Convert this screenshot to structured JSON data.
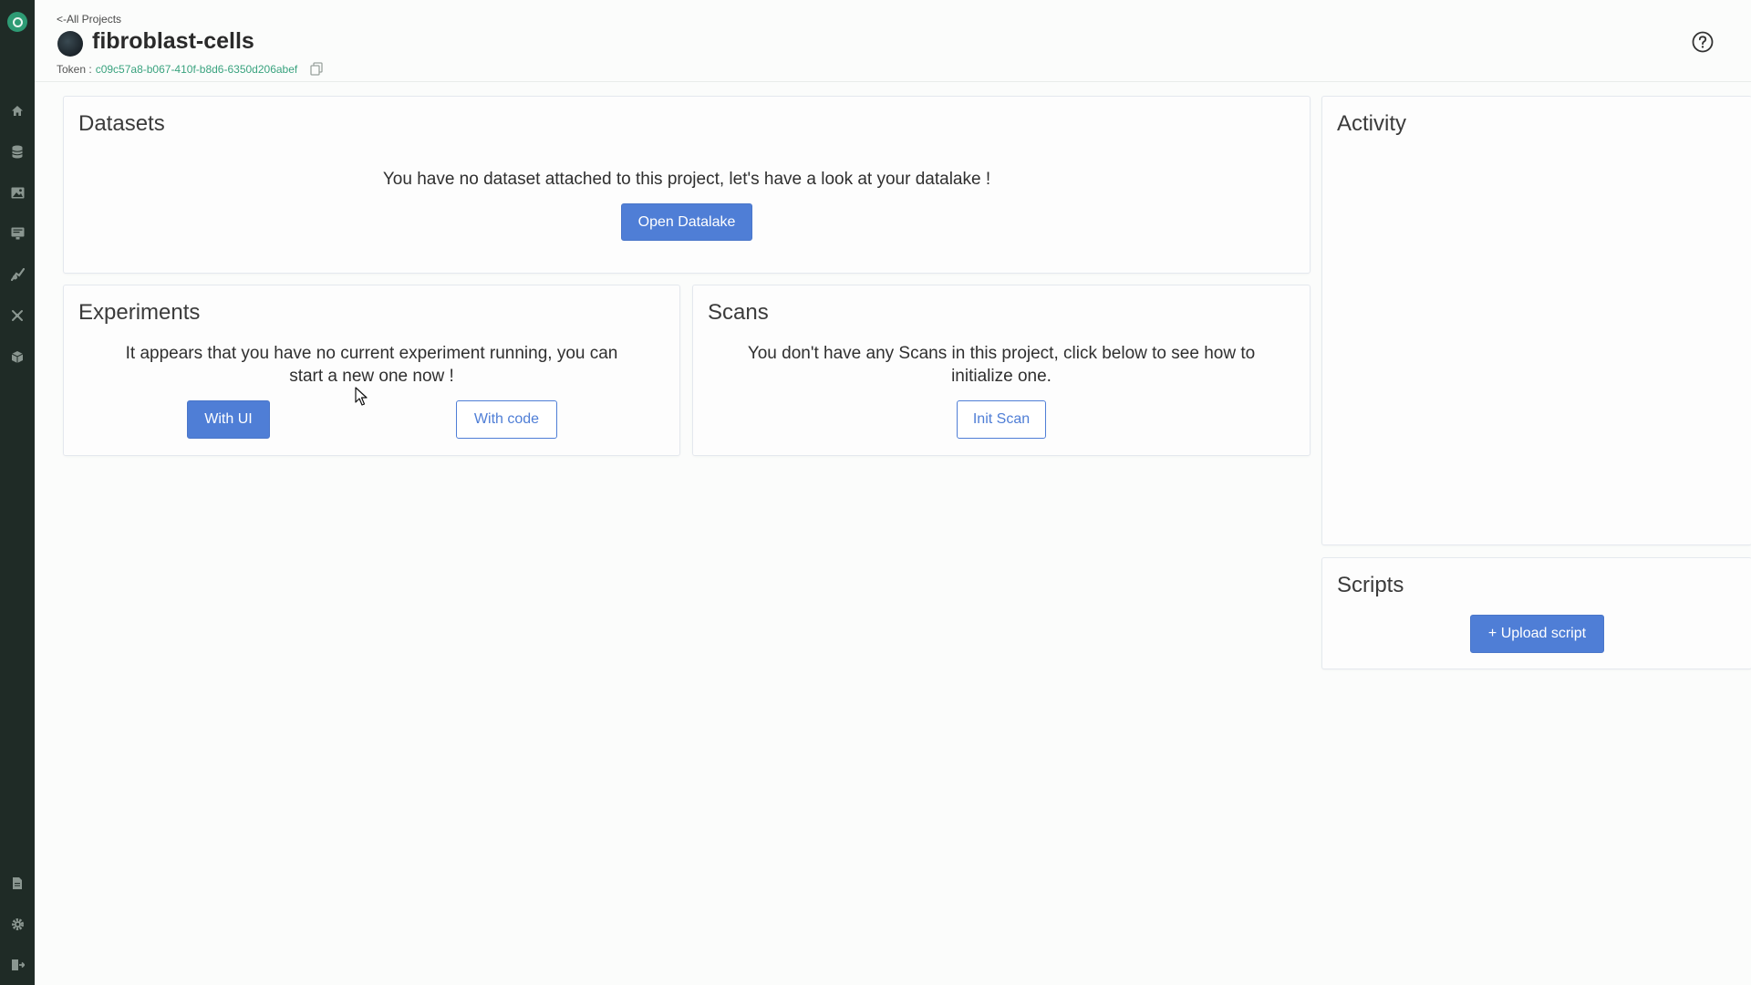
{
  "header": {
    "back_link": "<-All Projects",
    "project_name": "fibroblast-cells",
    "token_label": "Token :",
    "token_value": "c09c57a8-b067-410f-b8d6-6350d206abef"
  },
  "sidebar": {
    "top_icons": [
      "home-icon",
      "database-icon",
      "image-icon",
      "monitor-icon",
      "flask-icon",
      "experiments-icon",
      "cube-icon"
    ],
    "bottom_icons": [
      "document-icon",
      "settings-icon",
      "logout-icon"
    ]
  },
  "datasets": {
    "title": "Datasets",
    "message": "You have no dataset attached to this project, let's have a look at your datalake !",
    "button": "Open Datalake"
  },
  "experiments": {
    "title": "Experiments",
    "message_line1": "It appears that you have no current experiment running, you can",
    "message_line2": "start a new one now !",
    "button_ui": "With UI",
    "button_code": "With code"
  },
  "scans": {
    "title": "Scans",
    "message_line1": "You don't have any Scans in this project, click below to see how to",
    "message_line2": "initialize one.",
    "button": "Init Scan"
  },
  "activity": {
    "title": "Activity"
  },
  "scripts": {
    "title": "Scripts",
    "button": "+ Upload script"
  },
  "colors": {
    "sidebar_bg": "#1f2b26",
    "accent_green": "#3aa37f",
    "primary_blue": "#4f7ed6"
  }
}
